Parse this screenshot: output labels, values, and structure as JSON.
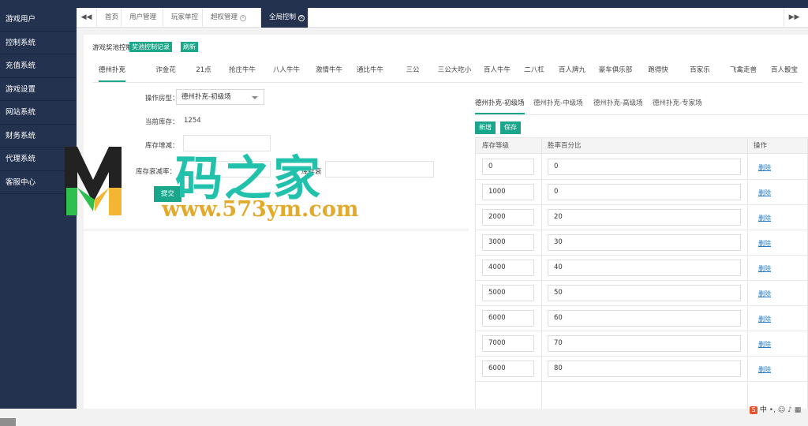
{
  "sidebar": {
    "items": [
      "游戏用户",
      "控制系统",
      "充值系统",
      "游戏设置",
      "网站系统",
      "财务系统",
      "代理系统",
      "客服中心"
    ]
  },
  "tabbar": {
    "prev": "◀◀",
    "next": "▶▶",
    "tabs": [
      {
        "label": "首页"
      },
      {
        "label": "用户管理"
      },
      {
        "label": "玩家单控"
      },
      {
        "label": "超权管理"
      },
      {
        "label": "全局控制",
        "active": true
      }
    ]
  },
  "header": {
    "title": "游戏奖池控制",
    "record_button": "奖池控制记录",
    "refresh_button": "刷新"
  },
  "game_tabs": [
    "德州扑克",
    "诈金花",
    "21点",
    "抢庄牛牛",
    "八人牛牛",
    "激情牛牛",
    "通比牛牛",
    "三公",
    "三公大吃小",
    "百人牛牛",
    "二八杠",
    "百人牌九",
    "豪车俱乐部",
    "跑得快",
    "百家乐",
    "飞禽走兽",
    "百人骰宝"
  ],
  "form": {
    "room_label": "操作房型：",
    "room_value": "德州扑克-初级场",
    "stock_label": "当前库存：",
    "stock_value": "1254",
    "adjust_label": "库存增减：",
    "decay_label": "库存衰减率：",
    "decay_label2": "库存衰",
    "submit_button": "提交"
  },
  "room_tabs": [
    "德州扑克-初级场",
    "德州扑克-中级场",
    "德州扑克-高级场",
    "德州扑克-专家场"
  ],
  "table": {
    "add_button": "新增",
    "save_button": "保存",
    "headers": [
      "库存等级",
      "胜率百分比",
      "操作"
    ],
    "delete_label": "删除",
    "rows": [
      {
        "level": "0",
        "rate": "0"
      },
      {
        "level": "1000",
        "rate": "0"
      },
      {
        "level": "2000",
        "rate": "20"
      },
      {
        "level": "3000",
        "rate": "30"
      },
      {
        "level": "4000",
        "rate": "40"
      },
      {
        "level": "5000",
        "rate": "50"
      },
      {
        "level": "6000",
        "rate": "60"
      },
      {
        "level": "7000",
        "rate": "70"
      },
      {
        "level": "6000",
        "rate": "80"
      }
    ]
  },
  "watermark": {
    "text": "码之家",
    "url": "www.573ym.com"
  },
  "tray": {
    "ime": "中"
  },
  "colors": {
    "sidebar": "#23324f",
    "accent": "#19a68a",
    "link": "#1e7bc8"
  }
}
